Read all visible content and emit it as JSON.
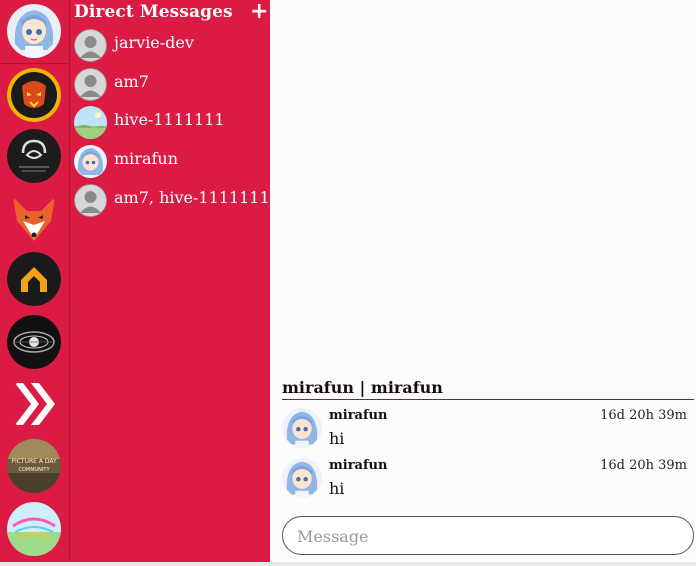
{
  "dm_panel": {
    "title": "Direct Messages",
    "add_icon": "plus-icon",
    "items": [
      {
        "label": "jarvie-dev",
        "avatar": "default-user-icon"
      },
      {
        "label": "am7",
        "avatar": "default-user-icon"
      },
      {
        "label": "hive-1111111",
        "avatar": "landscape-avatar"
      },
      {
        "label": "mirafun",
        "avatar": "anime-girl-avatar"
      },
      {
        "label": "am7, hive-1111111",
        "avatar": "default-user-icon"
      }
    ]
  },
  "rail": {
    "items": [
      {
        "name": "user-avatar"
      },
      {
        "name": "lion-community-icon"
      },
      {
        "name": "shadow-community-icon"
      },
      {
        "name": "fox-community-icon"
      },
      {
        "name": "arrow-community-icon"
      },
      {
        "name": "orb-community-icon"
      },
      {
        "name": "hive-chevron-icon"
      },
      {
        "name": "picture-community-icon"
      },
      {
        "name": "colorful-community-icon"
      }
    ]
  },
  "chat": {
    "header": "mirafun | mirafun",
    "messages": [
      {
        "author": "mirafun",
        "time": "16d 20h 39m",
        "text": "hi"
      },
      {
        "author": "mirafun",
        "time": "16d 20h 39m",
        "text": "hi"
      }
    ],
    "input_placeholder": "Message"
  },
  "colors": {
    "accent": "#dc1b44",
    "background": "#fcfcfc"
  }
}
